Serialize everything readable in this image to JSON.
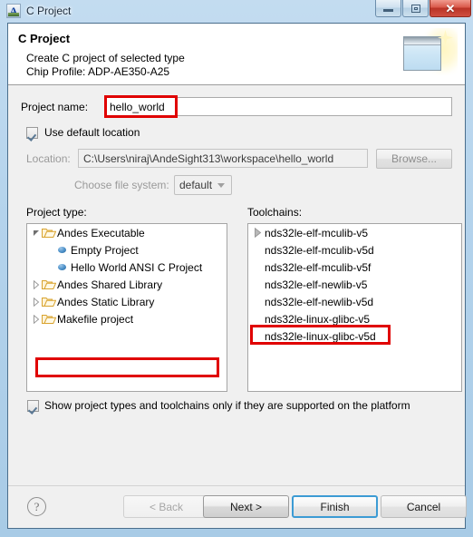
{
  "window": {
    "title": "C Project",
    "app_icon": "andesight-a-icon",
    "controls": {
      "minimize": "minimize-icon",
      "maximize": "maximize-icon",
      "close": "✕"
    }
  },
  "header": {
    "title": "C Project",
    "description": "Create C project of selected type",
    "chip_profile": "Chip Profile: ADP-AE350-A25",
    "banner_icon": "new-window-sparkle-icon"
  },
  "form": {
    "project_name_label": "Project name:",
    "project_name_value": "hello_world",
    "project_name_placeholder": "",
    "use_default_location_label": "Use default location",
    "use_default_location_checked": true,
    "location_label": "Location:",
    "location_value": "C:\\Users\\niraj\\AndeSight313\\workspace\\hello_world",
    "browse_label": "Browse...",
    "file_system_label": "Choose file system:",
    "file_system_value": "default",
    "file_system_options": [
      "default"
    ]
  },
  "project_type": {
    "label": "Project type:",
    "items": [
      {
        "label": "Andes Executable",
        "icon": "folder-icon",
        "twisty": "expanded",
        "indent": 0,
        "selected": false
      },
      {
        "label": "Empty Project",
        "icon": "sphere-icon",
        "twisty": "none",
        "indent": 1,
        "selected": false
      },
      {
        "label": "Hello World ANSI C Project",
        "icon": "sphere-icon",
        "twisty": "none",
        "indent": 1,
        "selected": true
      },
      {
        "label": "Andes Shared Library",
        "icon": "folder-icon",
        "twisty": "collapsed",
        "indent": 0,
        "selected": false
      },
      {
        "label": "Andes Static Library",
        "icon": "folder-icon",
        "twisty": "collapsed",
        "indent": 0,
        "selected": false
      },
      {
        "label": "Makefile project",
        "icon": "folder-icon",
        "twisty": "collapsed",
        "indent": 0,
        "selected": false
      }
    ]
  },
  "toolchains": {
    "label": "Toolchains:",
    "items": [
      {
        "label": "nds32le-elf-mculib-v5",
        "twisty": "solid",
        "selected": true
      },
      {
        "label": "nds32le-elf-mculib-v5d",
        "twisty": "none",
        "selected": false
      },
      {
        "label": "nds32le-elf-mculib-v5f",
        "twisty": "none",
        "selected": false
      },
      {
        "label": "nds32le-elf-newlib-v5",
        "twisty": "none",
        "selected": false
      },
      {
        "label": "nds32le-elf-newlib-v5d",
        "twisty": "none",
        "selected": false
      },
      {
        "label": "nds32le-linux-glibc-v5",
        "twisty": "none",
        "selected": false
      },
      {
        "label": "nds32le-linux-glibc-v5d",
        "twisty": "none",
        "selected": false
      }
    ]
  },
  "options": {
    "show_supported_label": "Show project types and toolchains only if they are supported on the platform",
    "show_supported_checked": true
  },
  "buttons": {
    "help": "?",
    "back": "< Back",
    "next": "Next >",
    "finish": "Finish",
    "cancel": "Cancel"
  },
  "colors": {
    "highlight_red": "#e00000",
    "default_button_focus": "#3c9bd4",
    "titlebar_blue": "#b4d3ec",
    "dialog_bg": "#f0f0f0"
  }
}
